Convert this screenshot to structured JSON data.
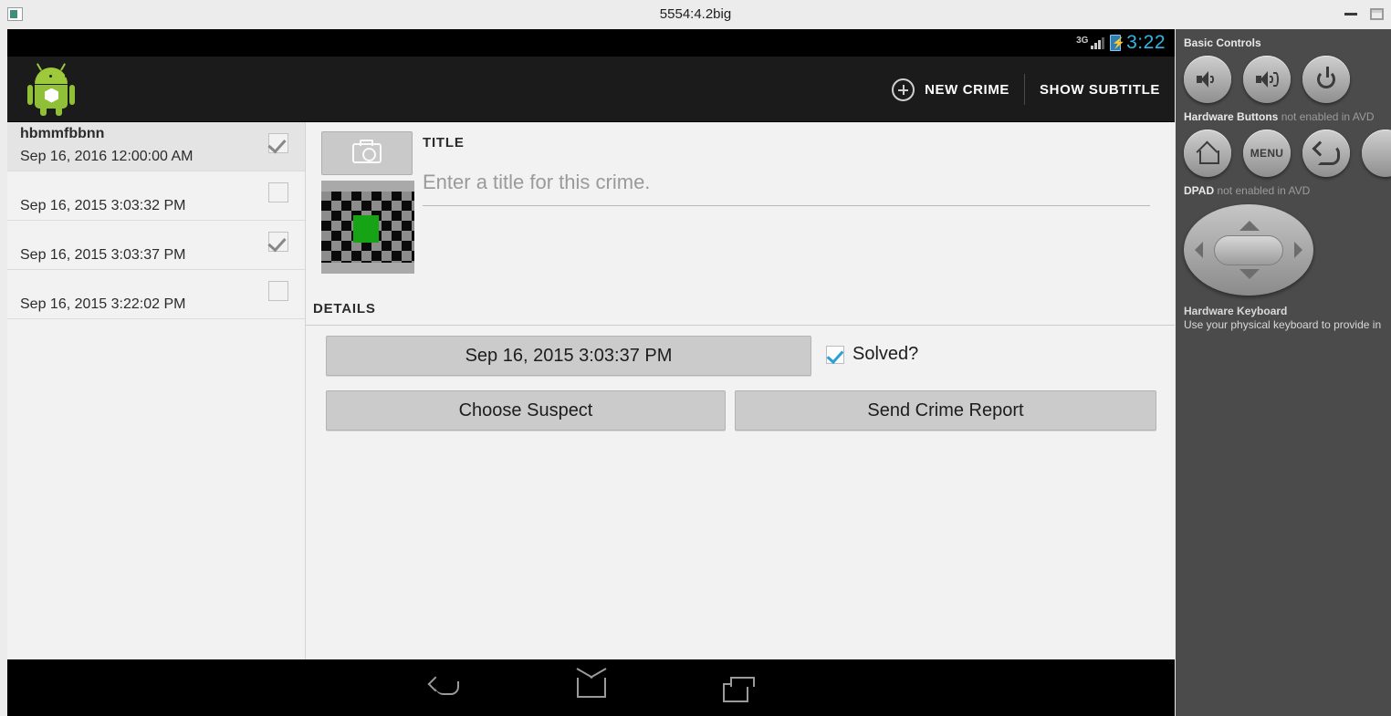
{
  "window": {
    "title": "5554:4.2big",
    "icon": "app-window-icon",
    "minimize_label": "Minimize",
    "maximize_label": "Maximize"
  },
  "device": {
    "statusbar": {
      "network": "3G",
      "battery_icon": "battery-charging-icon",
      "clock": "3:22"
    },
    "actionbar": {
      "app_icon": "android-robot-icon",
      "new_crime_label": "NEW CRIME",
      "new_crime_icon": "plus-circle-icon",
      "show_subtitle_label": "SHOW SUBTITLE"
    },
    "crime_list": [
      {
        "title": "hbmmfbbnn",
        "date": "Sep 16, 2016 12:00:00 AM",
        "solved": true,
        "selected": true
      },
      {
        "title": "",
        "date": "Sep 16, 2015 3:03:32 PM",
        "solved": false,
        "selected": false
      },
      {
        "title": "",
        "date": "Sep 16, 2015 3:03:37 PM",
        "solved": true,
        "selected": false
      },
      {
        "title": "",
        "date": "Sep 16, 2015 3:22:02 PM",
        "solved": false,
        "selected": false
      }
    ],
    "detail": {
      "camera_button_icon": "camera-icon",
      "photo_thumb_name": "crime-photo-thumbnail",
      "title_section_label": "TITLE",
      "title_placeholder": "Enter a title for this crime.",
      "title_value": "",
      "details_section_label": "DETAILS",
      "date_button_label": "Sep 16, 2015 3:03:37 PM",
      "solved_label": "Solved?",
      "solved_checked": true,
      "solved_check_color": "#2b9fd8",
      "choose_suspect_label": "Choose Suspect",
      "send_report_label": "Send Crime Report"
    },
    "navbar": {
      "back": "back-nav-icon",
      "home": "home-nav-icon",
      "recents": "recents-nav-icon"
    }
  },
  "emulator_panel": {
    "basic_controls_heading": "Basic Controls",
    "volume_down_label": "Volume Down",
    "volume_up_label": "Volume Up",
    "power_label": "Power",
    "hardware_buttons_heading": "Hardware Buttons",
    "hardware_buttons_note": " not enabled in AVD",
    "home_label": "Home",
    "menu_label": "MENU",
    "back_label": "Back",
    "dpad_heading": "DPAD",
    "dpad_note": " not enabled in AVD",
    "keyboard_heading": "Hardware Keyboard",
    "keyboard_note": "Use your physical keyboard to provide in"
  }
}
